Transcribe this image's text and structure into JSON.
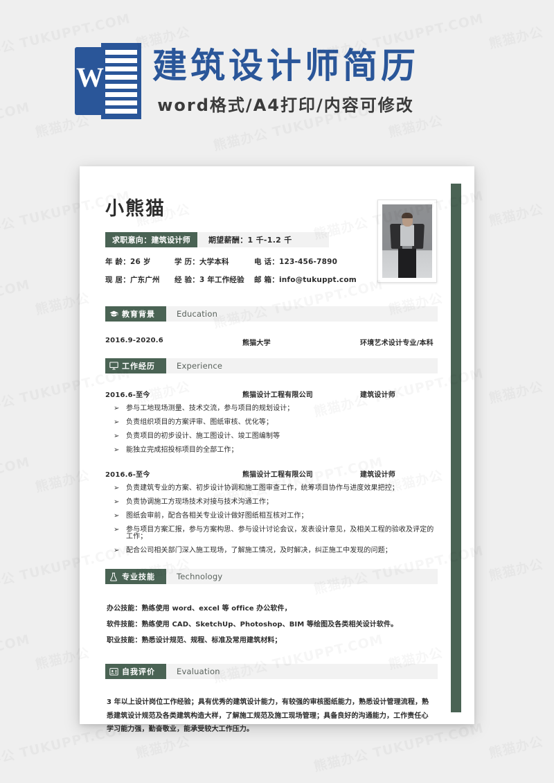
{
  "banner": {
    "logo_letter": "W",
    "title": "建筑设计师简历",
    "subtitle": "word格式/A4打印/内容可修改"
  },
  "resume": {
    "name": "小熊猫",
    "intent_label": "求职意向：建筑设计师",
    "salary_label": "期望薪酬：1 千-1.2 千",
    "info": [
      "年 龄：26 岁",
      "学 历：大学本科",
      "电 话：123-456-7890",
      "现 居：广东广州",
      "经 验：3 年工作经验",
      "邮 箱：info@tukuppt.com"
    ],
    "sections": {
      "education": {
        "cn": "教育背景",
        "en": "Education",
        "icon": "graduation-cap-icon",
        "rows": [
          {
            "period": "2016.9-2020.6",
            "org": "熊猫大学",
            "detail": "环境艺术设计专业/本科"
          }
        ]
      },
      "experience": {
        "cn": "工作经历",
        "en": "Experience",
        "icon": "monitor-icon",
        "jobs": [
          {
            "period": "2016.6-至今",
            "company": "熊猫设计工程有限公司",
            "role": "建筑设计师",
            "bullets": [
              "参与工地现场测量、技术交流，参与项目的规划设计；",
              "负责组织项目的方案评审、图纸审核、优化等；",
              "负责项目的初步设计、施工图设计、竣工图编制等",
              "能独立完成招投标项目的全部工作；"
            ]
          },
          {
            "period": "2016.6-至今",
            "company": "熊猫设计工程有限公司",
            "role": "建筑设计师",
            "bullets": [
              "负责建筑专业的方案、初步设计协调和施工图审查工作，统筹项目协作与进度效果把控；",
              "负责协调施工方现场技术对接与技术沟通工作；",
              "图纸会审前，配合各相关专业设计做好图纸相互核对工作；",
              "参与项目方案汇报，参与方案构思、参与设计讨论会议，发表设计意见，及相关工程的验收及评定的工作；",
              "配合公司相关部门深入施工现场，了解施工情况，及时解决，纠正施工中发现的问题；"
            ]
          }
        ]
      },
      "technology": {
        "cn": "专业技能",
        "en": "Technology",
        "icon": "flask-icon",
        "lines": [
          "办公技能：熟练使用 word、excel 等 office 办公软件，",
          "软件技能：熟练使用 CAD、SketchUp、Photoshop、BIM 等绘图及各类相关设计软件。",
          "职业技能：熟悉设计规范、规程、标准及常用建筑材料；"
        ]
      },
      "evaluation": {
        "cn": "自我评价",
        "en": "Evaluation",
        "icon": "id-card-icon",
        "text": "3 年以上设计岗位工作经验；具有优秀的建筑设计能力，有较强的审核图纸能力，熟悉设计管理流程，熟悉建筑设计规范及各类建筑构造大样，了解施工规范及施工现场管理；具备良好的沟通能力，工作责任心学习能力强，勤奋敬业，能承受较大工作压力。"
      }
    },
    "bullet_mark": "➢"
  },
  "watermark": {
    "text_a": "熊猫办公 TUKUPPT.COM",
    "text_b": "熊猫办公"
  },
  "colors": {
    "brand_blue": "#2a5699",
    "accent_green": "#4a6354",
    "band_gray": "#f2f2f2",
    "page_bg": "#efefef"
  }
}
